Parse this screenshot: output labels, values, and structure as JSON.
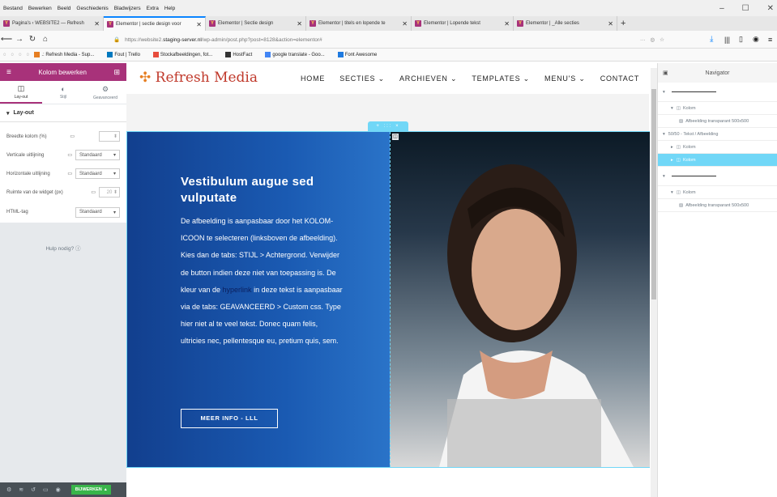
{
  "menubar": [
    "Bestand",
    "Bewerken",
    "Beeld",
    "Geschiedenis",
    "Bladwijzers",
    "Extra",
    "Help"
  ],
  "window_controls": [
    "–",
    "☐",
    "✕"
  ],
  "tabs": [
    {
      "label": "Pagina's ‹ WEBSITE2 — Refresh",
      "active": false
    },
    {
      "label": "Elementor | sectie design voor",
      "active": true
    },
    {
      "label": "Elementor | Sectie design",
      "active": false
    },
    {
      "label": "Elementor | titels en lopende te",
      "active": false
    },
    {
      "label": "Elementor | Lopende tekst",
      "active": false
    },
    {
      "label": "Elementor | _Alle secties",
      "active": false
    }
  ],
  "new_tab": "+",
  "url": {
    "prefix": "https://website2.",
    "host": "staging-server.nl",
    "path": "/wp-admin/post.php?post=8128&action=elementor#"
  },
  "bookmarks": [
    ".: Refresh Media - Sup...",
    "Fout | Trello",
    "Stockafbeeldingen, fot...",
    "HostFact",
    "google translate - Goo...",
    "Font Awesome"
  ],
  "panel": {
    "title": "Kolom bewerken",
    "tabs": [
      "Lay-out",
      "Stijl",
      "Geavanceerd"
    ],
    "section": "Lay-out",
    "controls": {
      "width_label": "Breedte kolom (%)",
      "valign_label": "Verticale uitlijning",
      "valign_value": "Standaard",
      "halign_label": "Horizontale uitlijning",
      "halign_value": "Standaard",
      "spacing_label": "Ruimte van de widget (px)",
      "spacing_value": "20",
      "html_tag_label": "HTML-tag",
      "html_tag_value": "Standaard"
    },
    "help": "Hulp nodig?",
    "publish": "BIJWERKEN"
  },
  "site": {
    "logo": "Refresh Media",
    "nav": [
      "HOME",
      "SECTIES ⌄",
      "ARCHIEVEN ⌄",
      "TEMPLATES ⌄",
      "MENU'S ⌄",
      "CONTACT"
    ],
    "section_handle": "+ ::: ×",
    "heading": "Vestibulum augue sed vulputate",
    "body_before": "De afbeelding is aanpasbaar door het KOLOM-ICOON te selecteren (linksboven de afbeelding). Kies dan de tabs: STIJL > Achtergrond. Verwijder de button indien deze niet van toepassing is. De kleur van de ",
    "body_link": "hyperlink",
    "body_after": " in deze tekst is aanpasbaar via de tabs: GEAVANCEERD > Custom css. Type hier niet al te veel tekst. Donec quam felis, ultricies nec, pellentesque eu, pretium quis, sem.",
    "cta": "MEER INFO - LLL"
  },
  "navigator": {
    "title": "Navigator",
    "rows": [
      {
        "label": "",
        "type": "section",
        "indent": 0
      },
      {
        "label": "Kolom",
        "type": "column",
        "indent": 1
      },
      {
        "label": "Afbeelding transparant 500x500",
        "type": "widget",
        "indent": 2
      },
      {
        "label": "50/50 - Tekst / Afbeelding",
        "type": "section",
        "indent": 0
      },
      {
        "label": "Kolom",
        "type": "column",
        "indent": 1
      },
      {
        "label": "Kolom",
        "type": "column",
        "indent": 1,
        "active": true
      },
      {
        "label": "",
        "type": "section",
        "indent": 0
      },
      {
        "label": "Kolom",
        "type": "column",
        "indent": 1
      },
      {
        "label": "Afbeelding transparant 500x500",
        "type": "widget",
        "indent": 2
      }
    ]
  },
  "colors": {
    "elementor_accent": "#a8327a",
    "selection": "#71d7f7",
    "publish": "#39b54a",
    "hero_blue": "#1a5ab2"
  }
}
